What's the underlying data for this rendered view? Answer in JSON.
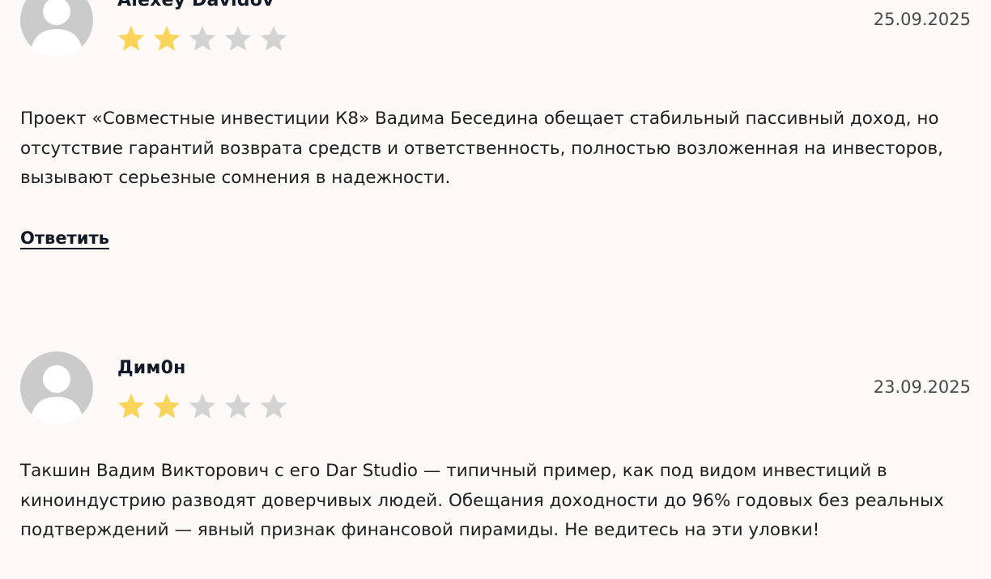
{
  "colors": {
    "background": "#fdf9f6",
    "star_filled": "#f9d35a",
    "star_empty": "#d3d3d3",
    "avatar": "#cbcbcb",
    "author_text": "#111826"
  },
  "reviews": [
    {
      "author": "Alexey Davidov",
      "date": "25.09.2025",
      "rating": 2,
      "max_rating": 5,
      "text": "Проект «Совместные инвестиции К8» Вадима Беседина обещает стабильный пассивный доход, но отсутствие гарантий возврата средств и ответственность, полностью возложенная на инвесторов, вызывают серьезные сомнения в надежности.",
      "reply_label": "Ответить",
      "avatar_icon": "user-placeholder-icon"
    },
    {
      "author": "Дим0н",
      "date": "23.09.2025",
      "rating": 2,
      "max_rating": 5,
      "text": "Такшин Вадим Викторович с его Dar Studio — типичный пример, как под видом инвестиций в киноиндустрию разводят доверчивых людей. Обещания доходности до 96% годовых без реальных подтверждений — явный признак финансовой пирамиды. Не ведитесь на эти уловки!",
      "avatar_icon": "user-placeholder-icon"
    }
  ]
}
